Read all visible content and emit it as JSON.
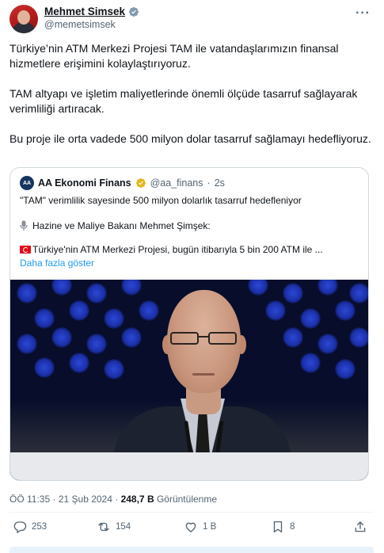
{
  "author": {
    "display_name": "Mehmet Simsek",
    "handle": "@memetsimsek"
  },
  "more_label": "···",
  "tweet": {
    "paragraphs": [
      "Türkiye’nin ATM Merkezi Projesi TAM ile vatandaşlarımızın finansal hizmetlere erişimini kolaylaştırıyoruz.",
      "TAM altyapı ve işletim maliyetlerinde önemli ölçüde tasarruf sağlayarak verimliliği artıracak.",
      "Bu proje ile orta vadede 500 milyon dolar tasarruf sağlamayı hedefliyoruz."
    ]
  },
  "quote": {
    "avatar_text": "AA",
    "display_name": "AA Ekonomi Finans",
    "handle": "@aa_finans",
    "separator": "·",
    "time": "2s",
    "line1": "\"TAM\" verimlilik sayesinde 500 milyon dolarlık tasarruf hedefleniyor",
    "line2": "Hazine ve Maliye Bakanı Mehmet Şimşek:",
    "line3": "Türkiye'nin ATM Merkezi Projesi, bugün itibarıyla 5 bin 200 ATM ile ...",
    "show_more": "Daha fazla göster"
  },
  "timestamp": {
    "time": "ÖÖ 11:35",
    "separator": "·",
    "date": "21 Şub 2024",
    "views_count": "248,7 B",
    "views_label": "Görüntülenme"
  },
  "actions": {
    "replies": "253",
    "retweets": "154",
    "likes": "1 B",
    "bookmarks": "8"
  },
  "colors": {
    "accent": "#1d9bf0",
    "text": "#0f1419",
    "muted": "#536471",
    "border": "#cfd9de"
  }
}
